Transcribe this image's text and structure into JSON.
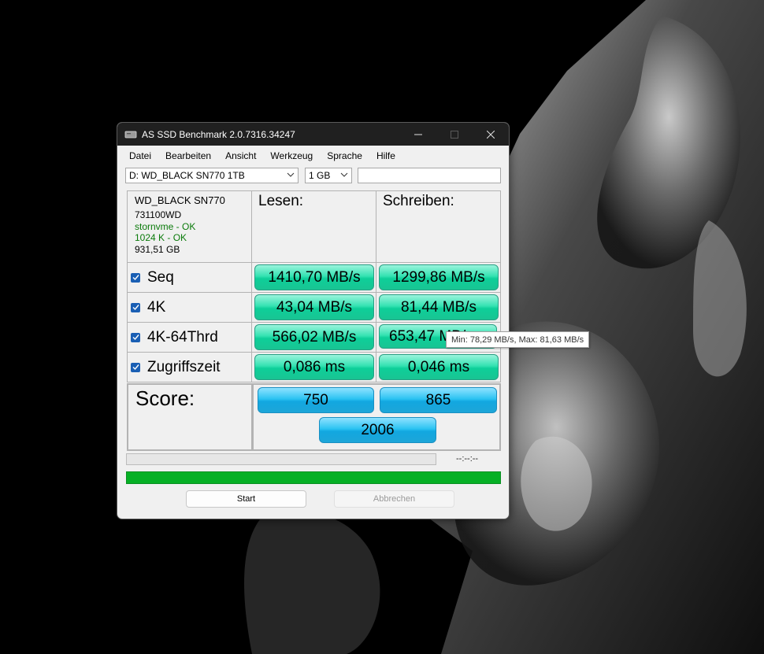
{
  "window": {
    "title": "AS SSD Benchmark 2.0.7316.34247"
  },
  "menu": [
    "Datei",
    "Bearbeiten",
    "Ansicht",
    "Werkzeug",
    "Sprache",
    "Hilfe"
  ],
  "toolbar": {
    "drive": "D: WD_BLACK SN770 1TB",
    "size": "1 GB",
    "text_value": ""
  },
  "drive_info": {
    "model": "WD_BLACK SN770",
    "firmware": "731100WD",
    "driver_status": "stornvme - OK",
    "alignment_status": "1024 K - OK",
    "capacity": "931,51 GB"
  },
  "columns": {
    "read": "Lesen:",
    "write": "Schreiben:"
  },
  "tests": [
    {
      "label": "Seq",
      "read": "1410,70 MB/s",
      "write": "1299,86 MB/s",
      "checked": true
    },
    {
      "label": "4K",
      "read": "43,04 MB/s",
      "write": "81,44 MB/s",
      "checked": true
    },
    {
      "label": "4K-64Thrd",
      "read": "566,02 MB/s",
      "write": "653,47 MB/s",
      "checked": true
    },
    {
      "label": "Zugriffszeit",
      "read": "0,086 ms",
      "write": "0,046 ms",
      "checked": true
    }
  ],
  "score": {
    "label": "Score:",
    "read": "750",
    "write": "865",
    "total": "2006"
  },
  "progress": {
    "time": "--:--:--",
    "current": 0,
    "overall": 1.0
  },
  "buttons": {
    "start": "Start",
    "cancel": "Abbrechen"
  },
  "tooltip": "Min: 78,29 MB/s, Max: 81,63 MB/s",
  "colors": {
    "result_green": "#19d6a0",
    "score_blue": "#1bb4ea",
    "progress_green": "#06b025",
    "status_green": "#0a7a0a"
  }
}
